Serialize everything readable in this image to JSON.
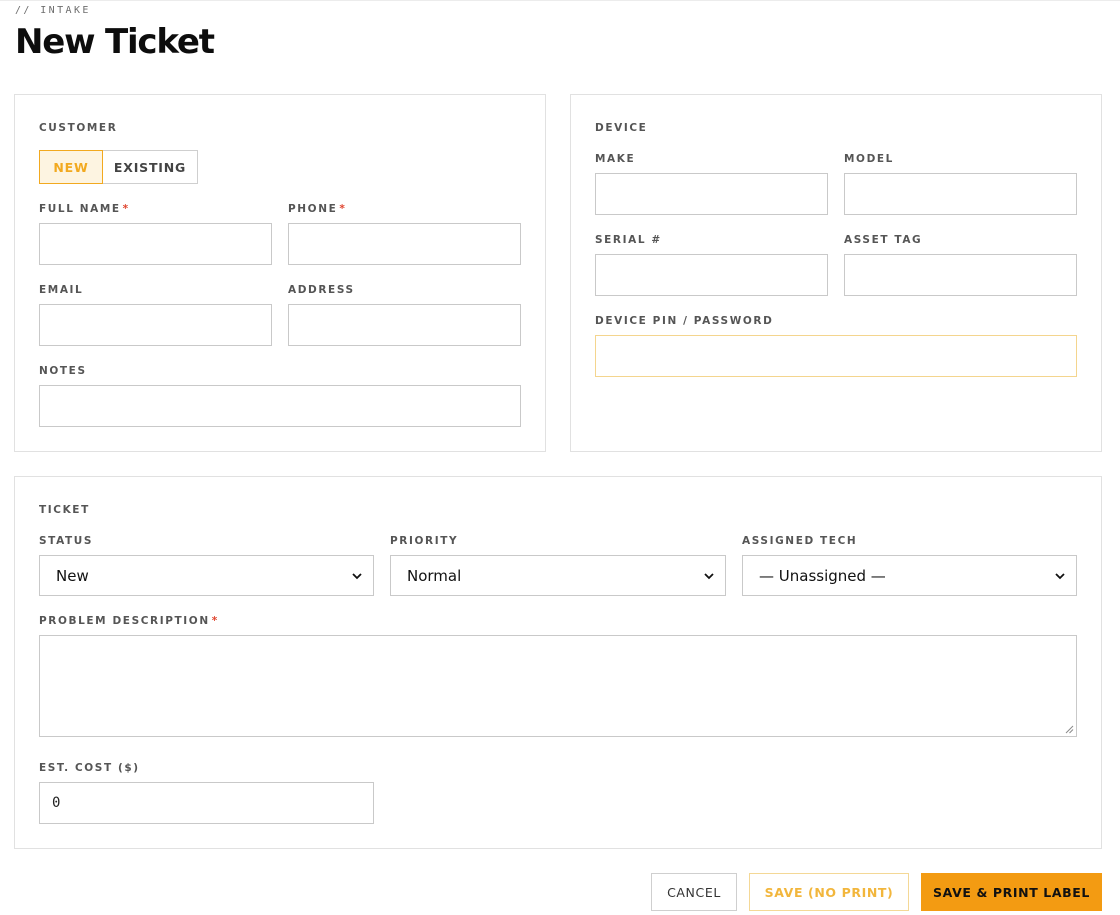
{
  "header": {
    "kicker": "// INTAKE",
    "title": "New Ticket"
  },
  "customer": {
    "section_label": "CUSTOMER",
    "toggle": {
      "new_label": "NEW",
      "existing_label": "EXISTING",
      "selected": "NEW"
    },
    "full_name_label": "FULL NAME",
    "phone_label": "PHONE",
    "email_label": "EMAIL",
    "address_label": "ADDRESS",
    "notes_label": "NOTES",
    "required_mark": "*"
  },
  "device": {
    "section_label": "DEVICE",
    "make_label": "MAKE",
    "model_label": "MODEL",
    "serial_label": "SERIAL #",
    "asset_tag_label": "ASSET TAG",
    "pin_label": "DEVICE PIN / PASSWORD"
  },
  "ticket": {
    "section_label": "TICKET",
    "status_label": "STATUS",
    "status_value": "New",
    "priority_label": "PRIORITY",
    "priority_value": "Normal",
    "tech_label": "ASSIGNED TECH",
    "tech_value": "— Unassigned —",
    "problem_label": "PROBLEM DESCRIPTION",
    "cost_label": "EST. COST ($)",
    "cost_value": "0"
  },
  "actions": {
    "cancel_label": "CANCEL",
    "save_label": "SAVE (NO PRINT)",
    "save_print_label": "SAVE & PRINT LABEL"
  },
  "colors": {
    "accent": "#f39b12",
    "required": "#e0452f",
    "border": "#c9c9c9"
  }
}
